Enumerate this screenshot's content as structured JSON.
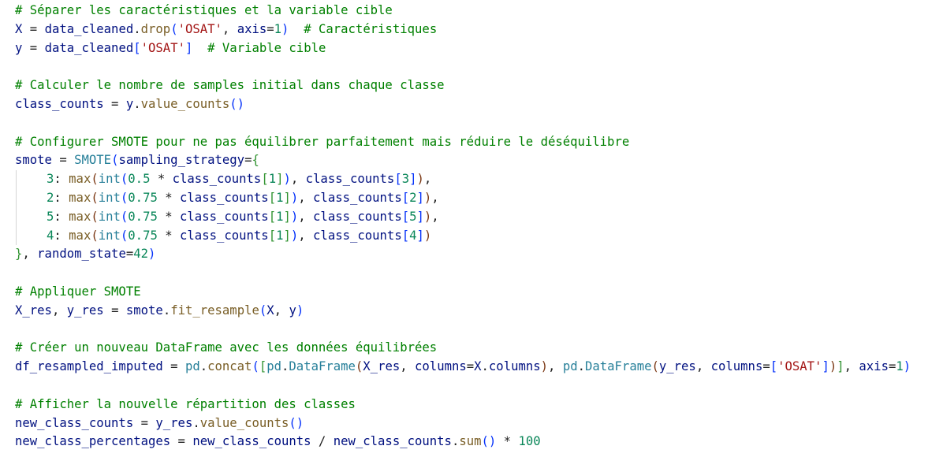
{
  "lines": [
    {
      "k": "code",
      "tokens": [
        {
          "t": "# Séparer les caractéristiques et la variable cible",
          "c": "cm"
        }
      ]
    },
    {
      "k": "code",
      "tokens": [
        {
          "t": "X",
          "c": "var"
        },
        {
          "t": " = ",
          "c": ""
        },
        {
          "t": "data_cleaned",
          "c": "var"
        },
        {
          "t": ".",
          "c": ""
        },
        {
          "t": "drop",
          "c": "fn"
        },
        {
          "t": "(",
          "c": "br1"
        },
        {
          "t": "'OSAT'",
          "c": "str"
        },
        {
          "t": ", ",
          "c": ""
        },
        {
          "t": "axis",
          "c": "var"
        },
        {
          "t": "=",
          "c": ""
        },
        {
          "t": "1",
          "c": "num"
        },
        {
          "t": ")",
          "c": "br1"
        },
        {
          "t": "  ",
          "c": ""
        },
        {
          "t": "# Caractéristiques",
          "c": "cm"
        }
      ]
    },
    {
      "k": "code",
      "tokens": [
        {
          "t": "y",
          "c": "var"
        },
        {
          "t": " = ",
          "c": ""
        },
        {
          "t": "data_cleaned",
          "c": "var"
        },
        {
          "t": "[",
          "c": "br1"
        },
        {
          "t": "'OSAT'",
          "c": "str"
        },
        {
          "t": "]",
          "c": "br1"
        },
        {
          "t": "  ",
          "c": ""
        },
        {
          "t": "# Variable cible",
          "c": "cm"
        }
      ]
    },
    {
      "k": "blank",
      "tokens": []
    },
    {
      "k": "code",
      "tokens": [
        {
          "t": "# Calculer le nombre de samples initial dans chaque classe",
          "c": "cm"
        }
      ]
    },
    {
      "k": "code",
      "tokens": [
        {
          "t": "class_counts",
          "c": "var"
        },
        {
          "t": " = ",
          "c": ""
        },
        {
          "t": "y",
          "c": "var"
        },
        {
          "t": ".",
          "c": ""
        },
        {
          "t": "value_counts",
          "c": "fn"
        },
        {
          "t": "()",
          "c": "br1"
        }
      ]
    },
    {
      "k": "blank",
      "tokens": []
    },
    {
      "k": "code",
      "tokens": [
        {
          "t": "# Configurer SMOTE pour ne pas équilibrer parfaitement mais réduire le déséquilibre",
          "c": "cm"
        }
      ]
    },
    {
      "k": "code",
      "tokens": [
        {
          "t": "smote",
          "c": "var"
        },
        {
          "t": " = ",
          "c": ""
        },
        {
          "t": "SMOTE",
          "c": "ty"
        },
        {
          "t": "(",
          "c": "br1"
        },
        {
          "t": "sampling_strategy",
          "c": "var"
        },
        {
          "t": "=",
          "c": ""
        },
        {
          "t": "{",
          "c": "br2"
        }
      ]
    },
    {
      "k": "indent",
      "tokens": [
        {
          "t": "3",
          "c": "num"
        },
        {
          "t": ": ",
          "c": ""
        },
        {
          "t": "max",
          "c": "fn"
        },
        {
          "t": "(",
          "c": "br3"
        },
        {
          "t": "int",
          "c": "ty"
        },
        {
          "t": "(",
          "c": "br1"
        },
        {
          "t": "0.5",
          "c": "num"
        },
        {
          "t": " * ",
          "c": ""
        },
        {
          "t": "class_counts",
          "c": "var"
        },
        {
          "t": "[",
          "c": "br2"
        },
        {
          "t": "1",
          "c": "num"
        },
        {
          "t": "]",
          "c": "br2"
        },
        {
          "t": ")",
          "c": "br1"
        },
        {
          "t": ", ",
          "c": ""
        },
        {
          "t": "class_counts",
          "c": "var"
        },
        {
          "t": "[",
          "c": "br1"
        },
        {
          "t": "3",
          "c": "num"
        },
        {
          "t": "]",
          "c": "br1"
        },
        {
          "t": ")",
          "c": "br3"
        },
        {
          "t": ",",
          "c": ""
        }
      ]
    },
    {
      "k": "indent",
      "tokens": [
        {
          "t": "2",
          "c": "num"
        },
        {
          "t": ": ",
          "c": ""
        },
        {
          "t": "max",
          "c": "fn"
        },
        {
          "t": "(",
          "c": "br3"
        },
        {
          "t": "int",
          "c": "ty"
        },
        {
          "t": "(",
          "c": "br1"
        },
        {
          "t": "0.75",
          "c": "num"
        },
        {
          "t": " * ",
          "c": ""
        },
        {
          "t": "class_counts",
          "c": "var"
        },
        {
          "t": "[",
          "c": "br2"
        },
        {
          "t": "1",
          "c": "num"
        },
        {
          "t": "]",
          "c": "br2"
        },
        {
          "t": ")",
          "c": "br1"
        },
        {
          "t": ", ",
          "c": ""
        },
        {
          "t": "class_counts",
          "c": "var"
        },
        {
          "t": "[",
          "c": "br1"
        },
        {
          "t": "2",
          "c": "num"
        },
        {
          "t": "]",
          "c": "br1"
        },
        {
          "t": ")",
          "c": "br3"
        },
        {
          "t": ",",
          "c": ""
        }
      ]
    },
    {
      "k": "indent",
      "tokens": [
        {
          "t": "5",
          "c": "num"
        },
        {
          "t": ": ",
          "c": ""
        },
        {
          "t": "max",
          "c": "fn"
        },
        {
          "t": "(",
          "c": "br3"
        },
        {
          "t": "int",
          "c": "ty"
        },
        {
          "t": "(",
          "c": "br1"
        },
        {
          "t": "0.75",
          "c": "num"
        },
        {
          "t": " * ",
          "c": ""
        },
        {
          "t": "class_counts",
          "c": "var"
        },
        {
          "t": "[",
          "c": "br2"
        },
        {
          "t": "1",
          "c": "num"
        },
        {
          "t": "]",
          "c": "br2"
        },
        {
          "t": ")",
          "c": "br1"
        },
        {
          "t": ", ",
          "c": ""
        },
        {
          "t": "class_counts",
          "c": "var"
        },
        {
          "t": "[",
          "c": "br1"
        },
        {
          "t": "5",
          "c": "num"
        },
        {
          "t": "]",
          "c": "br1"
        },
        {
          "t": ")",
          "c": "br3"
        },
        {
          "t": ",",
          "c": ""
        }
      ]
    },
    {
      "k": "indent",
      "tokens": [
        {
          "t": "4",
          "c": "num"
        },
        {
          "t": ": ",
          "c": ""
        },
        {
          "t": "max",
          "c": "fn"
        },
        {
          "t": "(",
          "c": "br3"
        },
        {
          "t": "int",
          "c": "ty"
        },
        {
          "t": "(",
          "c": "br1"
        },
        {
          "t": "0.75",
          "c": "num"
        },
        {
          "t": " * ",
          "c": ""
        },
        {
          "t": "class_counts",
          "c": "var"
        },
        {
          "t": "[",
          "c": "br2"
        },
        {
          "t": "1",
          "c": "num"
        },
        {
          "t": "]",
          "c": "br2"
        },
        {
          "t": ")",
          "c": "br1"
        },
        {
          "t": ", ",
          "c": ""
        },
        {
          "t": "class_counts",
          "c": "var"
        },
        {
          "t": "[",
          "c": "br1"
        },
        {
          "t": "4",
          "c": "num"
        },
        {
          "t": "]",
          "c": "br1"
        },
        {
          "t": ")",
          "c": "br3"
        }
      ]
    },
    {
      "k": "code",
      "tokens": [
        {
          "t": "}",
          "c": "br2"
        },
        {
          "t": ", ",
          "c": ""
        },
        {
          "t": "random_state",
          "c": "var"
        },
        {
          "t": "=",
          "c": ""
        },
        {
          "t": "42",
          "c": "num"
        },
        {
          "t": ")",
          "c": "br1"
        }
      ]
    },
    {
      "k": "blank",
      "tokens": []
    },
    {
      "k": "code",
      "tokens": [
        {
          "t": "# Appliquer SMOTE",
          "c": "cm"
        }
      ]
    },
    {
      "k": "code",
      "tokens": [
        {
          "t": "X_res",
          "c": "var"
        },
        {
          "t": ", ",
          "c": ""
        },
        {
          "t": "y_res",
          "c": "var"
        },
        {
          "t": " = ",
          "c": ""
        },
        {
          "t": "smote",
          "c": "var"
        },
        {
          "t": ".",
          "c": ""
        },
        {
          "t": "fit_resample",
          "c": "fn"
        },
        {
          "t": "(",
          "c": "br1"
        },
        {
          "t": "X",
          "c": "var"
        },
        {
          "t": ", ",
          "c": ""
        },
        {
          "t": "y",
          "c": "var"
        },
        {
          "t": ")",
          "c": "br1"
        }
      ]
    },
    {
      "k": "blank",
      "tokens": []
    },
    {
      "k": "code",
      "tokens": [
        {
          "t": "# Créer un nouveau DataFrame avec les données équilibrées",
          "c": "cm"
        }
      ]
    },
    {
      "k": "code",
      "tokens": [
        {
          "t": "df_resampled_imputed",
          "c": "var"
        },
        {
          "t": " = ",
          "c": ""
        },
        {
          "t": "pd",
          "c": "ty"
        },
        {
          "t": ".",
          "c": ""
        },
        {
          "t": "concat",
          "c": "fn"
        },
        {
          "t": "(",
          "c": "br1"
        },
        {
          "t": "[",
          "c": "br2"
        },
        {
          "t": "pd",
          "c": "ty"
        },
        {
          "t": ".",
          "c": ""
        },
        {
          "t": "DataFrame",
          "c": "ty"
        },
        {
          "t": "(",
          "c": "br3"
        },
        {
          "t": "X_res",
          "c": "var"
        },
        {
          "t": ", ",
          "c": ""
        },
        {
          "t": "columns",
          "c": "var"
        },
        {
          "t": "=",
          "c": ""
        },
        {
          "t": "X",
          "c": "var"
        },
        {
          "t": ".",
          "c": ""
        },
        {
          "t": "columns",
          "c": "var"
        },
        {
          "t": ")",
          "c": "br3"
        },
        {
          "t": ", ",
          "c": ""
        },
        {
          "t": "pd",
          "c": "ty"
        },
        {
          "t": ".",
          "c": ""
        },
        {
          "t": "DataFrame",
          "c": "ty"
        },
        {
          "t": "(",
          "c": "br3"
        },
        {
          "t": "y_res",
          "c": "var"
        },
        {
          "t": ", ",
          "c": ""
        },
        {
          "t": "columns",
          "c": "var"
        },
        {
          "t": "=",
          "c": ""
        },
        {
          "t": "[",
          "c": "br1"
        },
        {
          "t": "'OSAT'",
          "c": "str"
        },
        {
          "t": "]",
          "c": "br1"
        },
        {
          "t": ")",
          "c": "br3"
        },
        {
          "t": "]",
          "c": "br2"
        },
        {
          "t": ", ",
          "c": ""
        },
        {
          "t": "axis",
          "c": "var"
        },
        {
          "t": "=",
          "c": ""
        },
        {
          "t": "1",
          "c": "num"
        },
        {
          "t": ")",
          "c": "br1"
        }
      ]
    },
    {
      "k": "blank",
      "tokens": []
    },
    {
      "k": "code",
      "tokens": [
        {
          "t": "# Afficher la nouvelle répartition des classes",
          "c": "cm"
        }
      ]
    },
    {
      "k": "code",
      "tokens": [
        {
          "t": "new_class_counts",
          "c": "var"
        },
        {
          "t": " = ",
          "c": ""
        },
        {
          "t": "y_res",
          "c": "var"
        },
        {
          "t": ".",
          "c": ""
        },
        {
          "t": "value_counts",
          "c": "fn"
        },
        {
          "t": "()",
          "c": "br1"
        }
      ]
    },
    {
      "k": "code",
      "tokens": [
        {
          "t": "new_class_percentages",
          "c": "var"
        },
        {
          "t": " = ",
          "c": ""
        },
        {
          "t": "new_class_counts",
          "c": "var"
        },
        {
          "t": " / ",
          "c": ""
        },
        {
          "t": "new_class_counts",
          "c": "var"
        },
        {
          "t": ".",
          "c": ""
        },
        {
          "t": "sum",
          "c": "fn"
        },
        {
          "t": "()",
          "c": "br1"
        },
        {
          "t": " * ",
          "c": ""
        },
        {
          "t": "100",
          "c": "num"
        }
      ]
    }
  ]
}
